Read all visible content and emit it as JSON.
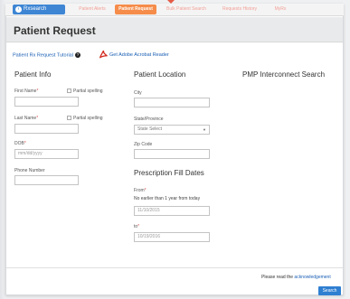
{
  "nav": {
    "back_label": "Rxsearch",
    "tabs": [
      {
        "label": "Patient Alerts",
        "active": false
      },
      {
        "label": "Patient Request",
        "active": true
      },
      {
        "label": "Bulk Patient Search",
        "active": false
      },
      {
        "label": "Requests History",
        "active": false
      },
      {
        "label": "MyRx",
        "active": false
      }
    ]
  },
  "page_title": "Patient Request",
  "links": {
    "tutorial": "Patient Rx Request Tutorial",
    "acrobat": "Get Adobe Acrobat Reader"
  },
  "patient_info": {
    "heading": "Patient Info",
    "first_name_label": "First Name",
    "last_name_label": "Last Name",
    "partial_spelling": "Partial spelling",
    "dob_label": "DOB",
    "dob_placeholder": "mm/dd/yyyy",
    "phone_label": "Phone Number"
  },
  "patient_location": {
    "heading": "Patient Location",
    "city_label": "City",
    "state_label": "State/Province",
    "state_value": "State Select",
    "zip_label": "Zip Code"
  },
  "fill_dates": {
    "heading": "Prescription Fill Dates",
    "from_label": "From",
    "from_note": "No earlier than 1 year from today",
    "from_value": "11/10/2015",
    "to_label": "to",
    "to_value": "10/19/2016"
  },
  "pmp": {
    "heading": "PMP Interconnect Search"
  },
  "footer": {
    "ack_prefix": "Please read the",
    "ack_link": "acknowledgement",
    "search_label": "Search"
  },
  "colors": {
    "accent_orange": "#f58c4a",
    "link_blue": "#1a5fb4",
    "button_blue": "#2f7fd1"
  }
}
